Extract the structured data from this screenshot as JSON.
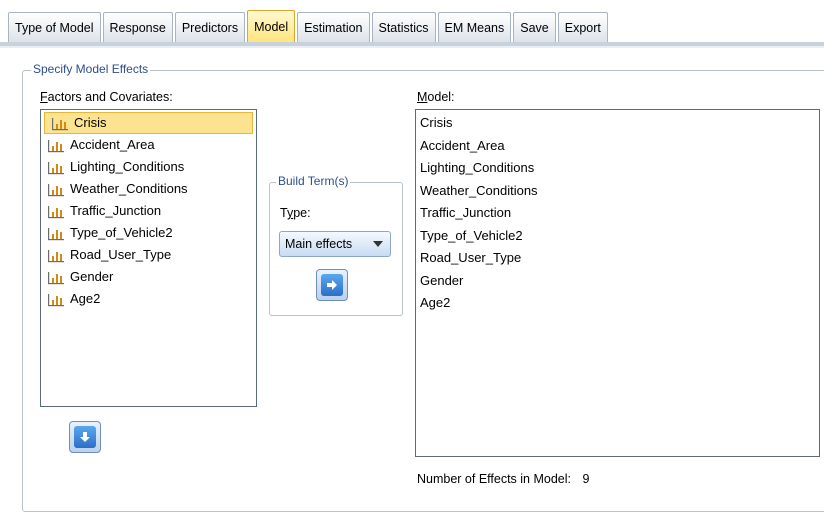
{
  "tabs": [
    {
      "label": "Type of Model",
      "active": false
    },
    {
      "label": "Response",
      "active": false
    },
    {
      "label": "Predictors",
      "active": false
    },
    {
      "label": "Model",
      "active": true
    },
    {
      "label": "Estimation",
      "active": false
    },
    {
      "label": "Statistics",
      "active": false
    },
    {
      "label": "EM Means",
      "active": false
    },
    {
      "label": "Save",
      "active": false
    },
    {
      "label": "Export",
      "active": false
    }
  ],
  "specify": {
    "legend": "Specify Model Effects",
    "factors_label_mnemonic": "F",
    "factors_label_rest": "actors and Covariates:",
    "factors": [
      "Crisis",
      "Accident_Area",
      "Lighting_Conditions",
      "Weather_Conditions",
      "Traffic_Junction",
      "Type_of_Vehicle2",
      "Road_User_Type",
      "Gender",
      "Age2"
    ],
    "selected_factor": "Crisis",
    "build": {
      "legend": "Build Term(s)",
      "type_label_pre": "T",
      "type_label_mnemonic": "y",
      "type_label_post": "pe:",
      "type_value": "Main effects"
    },
    "model_label_mnemonic": "M",
    "model_label_rest": "odel:",
    "model_terms": [
      "Crisis",
      "Accident_Area",
      "Lighting_Conditions",
      "Weather_Conditions",
      "Traffic_Junction",
      "Type_of_Vehicle2",
      "Road_User_Type",
      "Gender",
      "Age2"
    ],
    "effects_count_label": "Number of Effects in Model:",
    "effects_count": "9"
  },
  "icons": {
    "variable": "scale-variable-icon",
    "move_right": "arrow-right-icon",
    "move_down": "arrow-down-icon",
    "dropdown": "caret-down-icon"
  },
  "colors": {
    "selection_fill": "#fce390",
    "active_tab": "#ffe27a",
    "legend_text": "#2c4f8c",
    "arrow_blue": "#2c6fc6"
  }
}
